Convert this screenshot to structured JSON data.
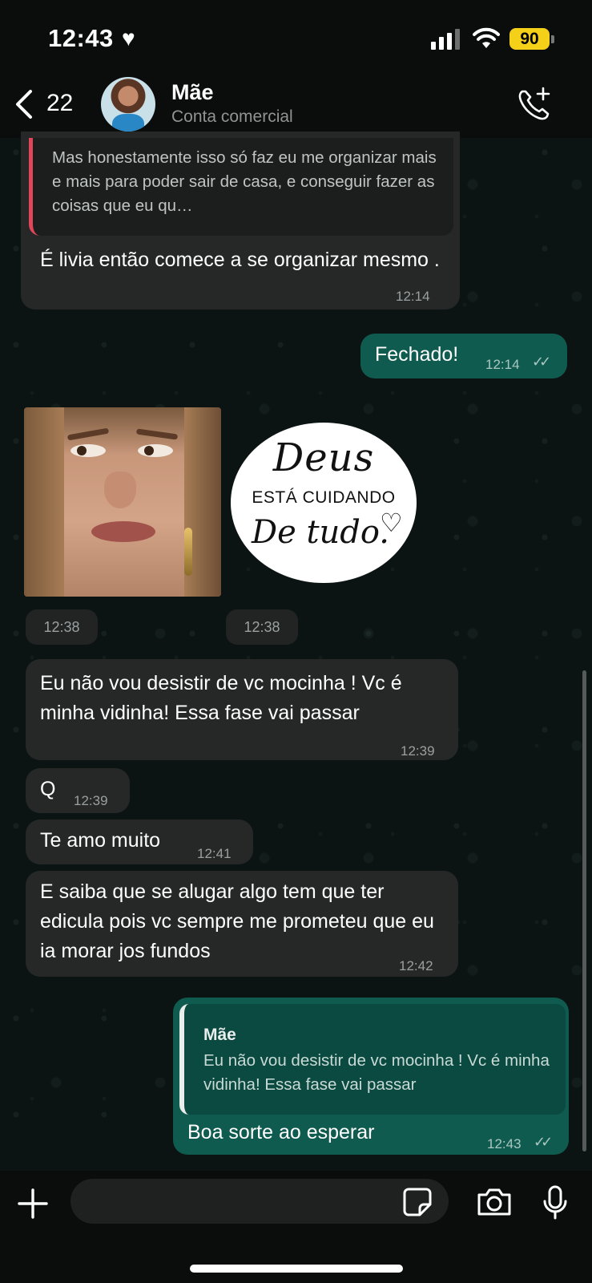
{
  "status_bar": {
    "time": "12:43",
    "battery": "90"
  },
  "header": {
    "back_count": "22",
    "contact_name": "Mãe",
    "contact_subtitle": "Conta comercial"
  },
  "messages": {
    "m1_quote": "Mas honestamente isso só faz eu me organizar mais e mais para poder sair de casa, e conseguir fazer as coisas que eu qu…",
    "m1_text": "É livia então  comece  a se organizar mesmo .",
    "m1_time": "12:14",
    "m2_text": "Fechado!",
    "m2_time": "12:14",
    "sticker1_time": "12:38",
    "sticker2_time": "12:38",
    "sticker2": {
      "line1": "Deus",
      "line2": "ESTÁ CUIDANDO",
      "line3": "De tudo."
    },
    "m3_text": "Eu não vou desistir de vc mocinha ! Vc é  minha vidinha!  Essa fase vai passar",
    "m3_time": "12:39",
    "m4_text": "Q",
    "m4_time": "12:39",
    "m5_text": "Te amo muito",
    "m5_time": "12:41",
    "m6_text": "E saiba que se alugar algo tem que ter edicula pois  vc sempre me prometeu que eu ia morar jos fundos",
    "m6_time": "12:42",
    "m7_quote_name": "Mãe",
    "m7_quote_text": "Eu não vou desistir de vc mocinha ! Vc é minha vidinha!  Essa fase vai passar",
    "m7_text": "Boa sorte ao esperar",
    "m7_time": "12:43"
  },
  "colors": {
    "incoming_bubble": "#262828",
    "outgoing_bubble": "#0f5b4f",
    "quote_accent": "#e0455a",
    "battery": "#f4d019"
  },
  "icons": [
    "heart-icon",
    "signal-icon",
    "wifi-icon",
    "back-chevron-icon",
    "add-call-icon",
    "plus-icon",
    "sticker-icon",
    "camera-icon",
    "mic-icon",
    "double-check-icon"
  ]
}
